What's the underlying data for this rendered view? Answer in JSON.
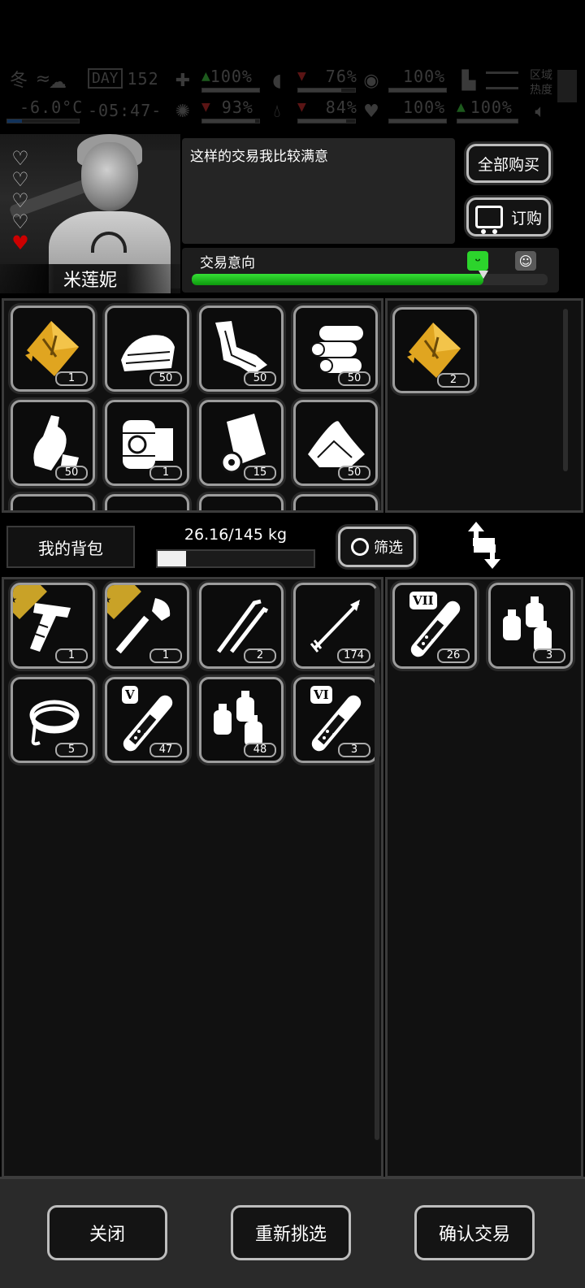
{
  "hud": {
    "season": "冬",
    "temperature": "-6.0°C",
    "day_label": "DAY",
    "day_number": "152",
    "time": "-05:47-",
    "medical_pct": "100%",
    "food_pct": "76%",
    "armor_pct": "100%",
    "sanity_pct": "93%",
    "water_pct": "84%",
    "health_pct": "100%",
    "leg_pct": "100%",
    "region_line1": "区域",
    "region_line2": "热度"
  },
  "merchant": {
    "name": "米莲妮",
    "dialogue": "这样的交易我比较满意",
    "intent_label": "交易意向",
    "intent_level": 0.82,
    "hearts": [
      "full",
      "full",
      "full",
      "full",
      "low"
    ],
    "buy_all_label": "全部购买",
    "order_label": "订购"
  },
  "merchant_items": [
    {
      "icon": "gold-ore-icon",
      "count": "1"
    },
    {
      "icon": "cloth-icon",
      "count": "50"
    },
    {
      "icon": "scrap-metal-icon",
      "count": "50"
    },
    {
      "icon": "logs-icon",
      "count": "50"
    },
    {
      "icon": "plastic-bottles-icon",
      "count": "50"
    },
    {
      "icon": "machine-parts-icon",
      "count": "1"
    },
    {
      "icon": "paper-roll-icon",
      "count": "15"
    },
    {
      "icon": "sand-pile-icon",
      "count": "50"
    }
  ],
  "merchant_offer": [
    {
      "icon": "gold-ore-icon",
      "count": "2"
    }
  ],
  "bag": {
    "title": "我的背包",
    "weight": "26.16/145 kg",
    "weight_fraction": 0.18,
    "filter_label": "筛选"
  },
  "bag_items": [
    {
      "icon": "hatchet-icon",
      "count": "1",
      "starred": true
    },
    {
      "icon": "shovel-icon",
      "count": "1",
      "starred": true
    },
    {
      "icon": "lockpick-icon",
      "count": "2"
    },
    {
      "icon": "arrow-icon",
      "count": "174"
    },
    {
      "icon": "rope-icon",
      "count": "5"
    },
    {
      "icon": "test-tube-icon",
      "count": "47",
      "tier": "V"
    },
    {
      "icon": "spray-cans-icon",
      "count": "48"
    },
    {
      "icon": "test-tube-icon",
      "count": "3",
      "tier": "VI"
    }
  ],
  "bag_offer": [
    {
      "icon": "test-tube-icon",
      "count": "26",
      "tier": "VII"
    },
    {
      "icon": "spray-cans-icon",
      "count": "3"
    }
  ],
  "actions": {
    "close": "关闭",
    "reselect": "重新挑选",
    "confirm": "确认交易"
  }
}
